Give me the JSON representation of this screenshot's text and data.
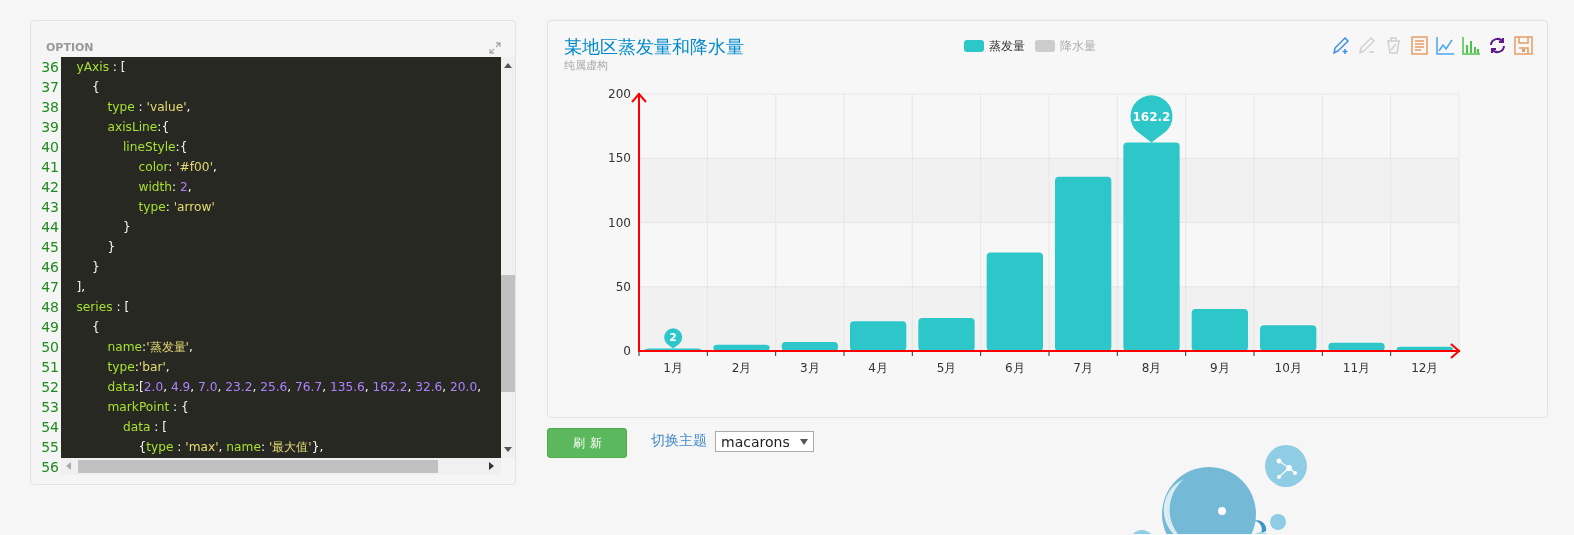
{
  "editor": {
    "title": "OPTION",
    "lines": [
      {
        "number": "36",
        "tokens": [
          {
            "kind": "key",
            "text": "    yAxis"
          },
          {
            "kind": "punct",
            "text": " : ["
          }
        ]
      },
      {
        "number": "37",
        "tokens": [
          {
            "kind": "punct",
            "text": "        {"
          }
        ]
      },
      {
        "number": "38",
        "tokens": [
          {
            "kind": "key",
            "text": "            type"
          },
          {
            "kind": "punct",
            "text": " : "
          },
          {
            "kind": "string",
            "text": "'value'"
          },
          {
            "kind": "punct",
            "text": ","
          }
        ]
      },
      {
        "number": "39",
        "tokens": [
          {
            "kind": "key",
            "text": "            axisLine"
          },
          {
            "kind": "punct",
            "text": ":{"
          }
        ]
      },
      {
        "number": "40",
        "tokens": [
          {
            "kind": "key",
            "text": "                lineStyle"
          },
          {
            "kind": "punct",
            "text": ":{"
          }
        ]
      },
      {
        "number": "41",
        "tokens": [
          {
            "kind": "key",
            "text": "                    color"
          },
          {
            "kind": "punct",
            "text": ": "
          },
          {
            "kind": "string",
            "text": "'#f00'"
          },
          {
            "kind": "punct",
            "text": ","
          }
        ]
      },
      {
        "number": "42",
        "tokens": [
          {
            "kind": "key",
            "text": "                    width"
          },
          {
            "kind": "punct",
            "text": ": "
          },
          {
            "kind": "number",
            "text": "2"
          },
          {
            "kind": "punct",
            "text": ","
          }
        ]
      },
      {
        "number": "43",
        "tokens": [
          {
            "kind": "key",
            "text": "                    type"
          },
          {
            "kind": "punct",
            "text": ": "
          },
          {
            "kind": "string",
            "text": "'arrow'"
          }
        ]
      },
      {
        "number": "44",
        "tokens": [
          {
            "kind": "punct",
            "text": "                }"
          }
        ]
      },
      {
        "number": "45",
        "tokens": [
          {
            "kind": "punct",
            "text": "            }"
          }
        ]
      },
      {
        "number": "46",
        "tokens": [
          {
            "kind": "punct",
            "text": "        }"
          }
        ]
      },
      {
        "number": "47",
        "tokens": [
          {
            "kind": "punct",
            "text": "    ],"
          }
        ]
      },
      {
        "number": "48",
        "tokens": [
          {
            "kind": "key",
            "text": "    series"
          },
          {
            "kind": "punct",
            "text": " : ["
          }
        ]
      },
      {
        "number": "49",
        "tokens": [
          {
            "kind": "punct",
            "text": "        {"
          }
        ]
      },
      {
        "number": "50",
        "tokens": [
          {
            "kind": "key",
            "text": "            name"
          },
          {
            "kind": "punct",
            "text": ":"
          },
          {
            "kind": "string",
            "text": "'蒸发量'"
          },
          {
            "kind": "punct",
            "text": ","
          }
        ]
      },
      {
        "number": "51",
        "tokens": [
          {
            "kind": "key",
            "text": "            type"
          },
          {
            "kind": "punct",
            "text": ":"
          },
          {
            "kind": "string",
            "text": "'bar'"
          },
          {
            "kind": "punct",
            "text": ","
          }
        ]
      },
      {
        "number": "52",
        "tokens": [
          {
            "kind": "key",
            "text": "            data"
          },
          {
            "kind": "punct",
            "text": ":["
          },
          {
            "kind": "number",
            "text": "2.0"
          },
          {
            "kind": "punct",
            "text": ", "
          },
          {
            "kind": "number",
            "text": "4.9"
          },
          {
            "kind": "punct",
            "text": ", "
          },
          {
            "kind": "number",
            "text": "7.0"
          },
          {
            "kind": "punct",
            "text": ", "
          },
          {
            "kind": "number",
            "text": "23.2"
          },
          {
            "kind": "punct",
            "text": ", "
          },
          {
            "kind": "number",
            "text": "25.6"
          },
          {
            "kind": "punct",
            "text": ", "
          },
          {
            "kind": "number",
            "text": "76.7"
          },
          {
            "kind": "punct",
            "text": ", "
          },
          {
            "kind": "number",
            "text": "135.6"
          },
          {
            "kind": "punct",
            "text": ", "
          },
          {
            "kind": "number",
            "text": "162.2"
          },
          {
            "kind": "punct",
            "text": ", "
          },
          {
            "kind": "number",
            "text": "32.6"
          },
          {
            "kind": "punct",
            "text": ", "
          },
          {
            "kind": "number",
            "text": "20.0"
          },
          {
            "kind": "punct",
            "text": ","
          }
        ]
      },
      {
        "number": "53",
        "tokens": [
          {
            "kind": "key",
            "text": "            markPoint"
          },
          {
            "kind": "punct",
            "text": " : {"
          }
        ]
      },
      {
        "number": "54",
        "tokens": [
          {
            "kind": "key",
            "text": "                data"
          },
          {
            "kind": "punct",
            "text": " : ["
          }
        ]
      },
      {
        "number": "55",
        "tokens": [
          {
            "kind": "punct",
            "text": "                    {"
          },
          {
            "kind": "key",
            "text": "type"
          },
          {
            "kind": "punct",
            "text": " : "
          },
          {
            "kind": "string",
            "text": "'max'"
          },
          {
            "kind": "punct",
            "text": ", "
          },
          {
            "kind": "key",
            "text": "name"
          },
          {
            "kind": "punct",
            "text": ": "
          },
          {
            "kind": "string",
            "text": "'最大值'"
          },
          {
            "kind": "punct",
            "text": "},"
          }
        ]
      },
      {
        "number": "56"
      }
    ]
  },
  "chart": {
    "title": "某地区蒸发量和降水量",
    "subtitle": "纯属虚构",
    "legend": [
      {
        "selected": true
      },
      {
        "label": "降水量",
        "selected": false
      }
    ],
    "toolbox": [
      {
        "kind": "mark",
        "disabled": false
      },
      {
        "kind": "unmark",
        "disabled": true
      },
      {
        "kind": "clear",
        "disabled": true
      },
      {
        "kind": "data-view",
        "disabled": false
      },
      {
        "kind": "line",
        "disabled": false
      },
      {
        "kind": "bar",
        "disabled": false
      },
      {
        "kind": "restore",
        "disabled": false
      },
      {
        "kind": "save",
        "disabled": false
      }
    ],
    "chart_data": {
      "type": "bar",
      "categories": [
        "1月",
        "2月",
        "3月",
        "4月",
        "5月",
        "6月",
        "7月",
        "8月",
        "9月",
        "10月",
        "11月",
        "12月"
      ],
      "series": [
        {
          "name": "蒸发量",
          "color": "#2ec7c9",
          "values": [
            2.0,
            4.9,
            7.0,
            23.2,
            25.6,
            76.7,
            135.6,
            162.2,
            32.6,
            20.0,
            6.4,
            3.3
          ]
        }
      ],
      "ylim": [
        0,
        200
      ],
      "yticks": [
        {
          "value": 0,
          "label": "0"
        },
        {
          "value": 50,
          "label": "50"
        },
        {
          "value": 100,
          "label": "100"
        },
        {
          "value": 150,
          "label": "150"
        },
        {
          "value": 200,
          "label": "200"
        }
      ],
      "grid": true,
      "annotations": [
        {
          "x": "1月",
          "y": 2.0,
          "text": "2"
        },
        {
          "x": "8月",
          "y": 162.2,
          "text": "162.2"
        }
      ]
    }
  },
  "controls": {
    "refresh_button": "刷新",
    "theme_label": "切换主题",
    "theme_value": "macarons"
  }
}
